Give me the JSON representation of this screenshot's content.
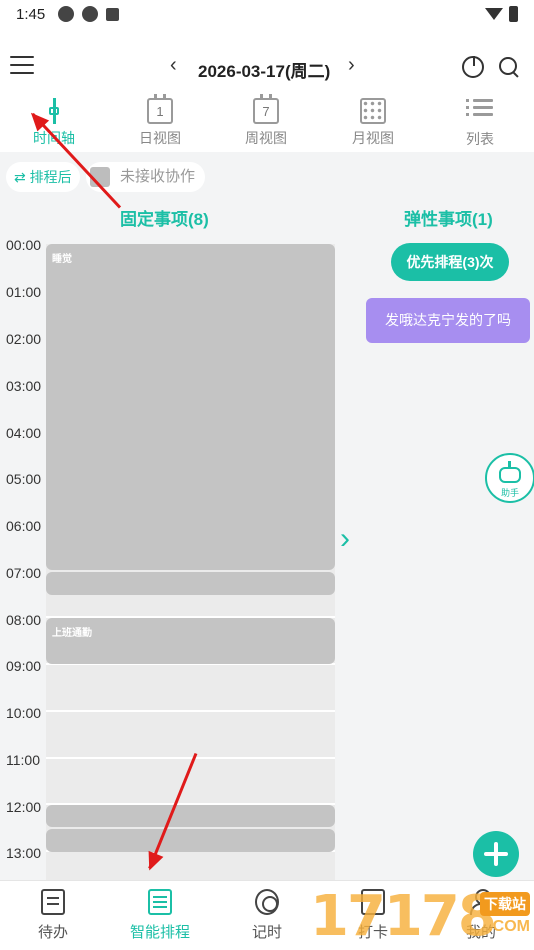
{
  "status_bar": {
    "time": "1:45"
  },
  "header": {
    "date_title": "2026-03-17(周二)",
    "prev_glyph": "‹",
    "next_glyph": "›",
    "icons": [
      "menu-icon",
      "pie-chart-icon",
      "search-icon"
    ]
  },
  "view_tabs": [
    {
      "label": "时间轴",
      "icon": "timeline-icon",
      "active": true
    },
    {
      "label": "日视图",
      "icon": "calendar-day-icon",
      "icon_text": "1"
    },
    {
      "label": "周视图",
      "icon": "calendar-week-icon",
      "icon_text": "7"
    },
    {
      "label": "月视图",
      "icon": "calendar-month-icon"
    },
    {
      "label": "列表",
      "icon": "list-icon"
    }
  ],
  "filters": {
    "sort_label": "⇄ 排程后",
    "collab_label": "未接收协作"
  },
  "fixed": {
    "title": "固定事项(8)",
    "events": [
      {
        "title": "睡觉"
      },
      {
        "title": "上班通勤"
      }
    ]
  },
  "flexible": {
    "title": "弹性事项(1)",
    "priority_button": "优先排程(3)次",
    "items": [
      "发哦达克宁发的了吗"
    ]
  },
  "time_labels": [
    "00:00",
    "01:00",
    "02:00",
    "03:00",
    "04:00",
    "05:00",
    "06:00",
    "07:00",
    "08:00",
    "09:00",
    "10:00",
    "11:00",
    "12:00",
    "13:00"
  ],
  "assistant": {
    "label": "助手",
    "icon": "robot-icon"
  },
  "fab": {
    "icon": "plus-icon"
  },
  "bottom_nav": [
    {
      "label": "待办",
      "icon": "todo-icon"
    },
    {
      "label": "智能排程",
      "icon": "smart-schedule-icon",
      "active": true
    },
    {
      "label": "记时",
      "icon": "timer-icon"
    },
    {
      "label": "打卡",
      "icon": "punch-icon"
    },
    {
      "label": "我的",
      "icon": "profile-icon"
    }
  ],
  "watermark": {
    "number": "17178",
    "tag": "下载站",
    "domain": ".COM"
  },
  "colors": {
    "accent": "#1bbfa6",
    "event_gray": "#c4c4c4",
    "flex_purple": "#a78ef0",
    "annotation_red": "#e01a1a"
  }
}
